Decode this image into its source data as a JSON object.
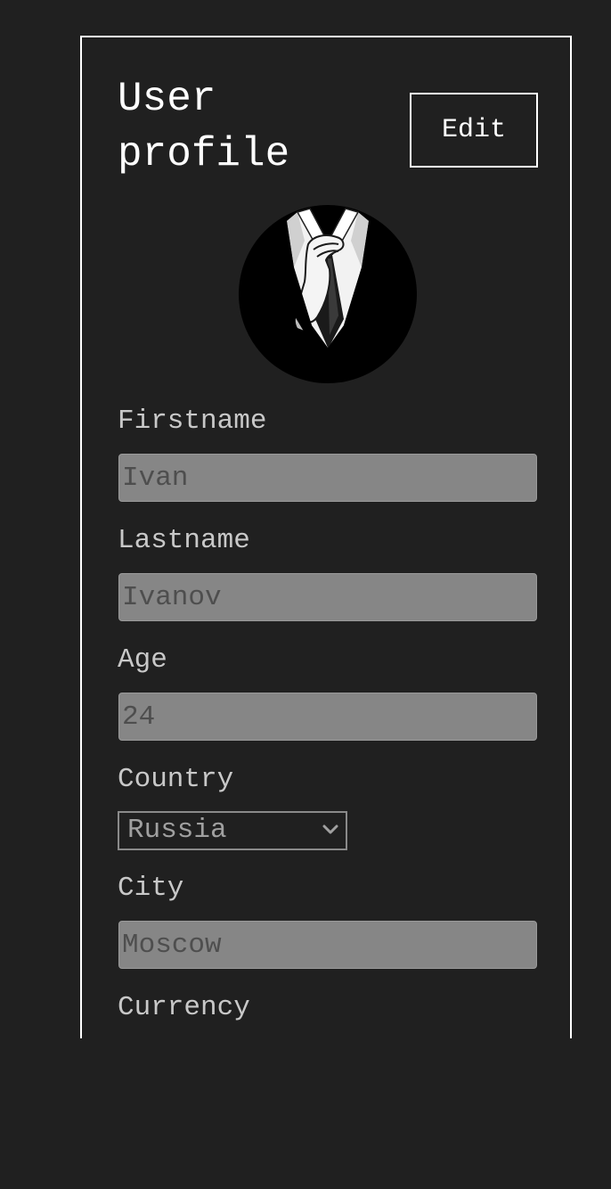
{
  "profile": {
    "title": "User profile",
    "edit_label": "Edit",
    "avatar_icon": "suit-tie-avatar-icon"
  },
  "form": {
    "firstname_label": "Firstname",
    "firstname_value": "Ivan",
    "lastname_label": "Lastname",
    "lastname_value": "Ivanov",
    "age_label": "Age",
    "age_value": "24",
    "country_label": "Country",
    "country_value": "Russia",
    "city_label": "City",
    "city_value": "Moscow",
    "currency_label": "Currency"
  },
  "colors": {
    "background": "#202020",
    "field_bg": "#868686",
    "field_text": "#4e4e4e",
    "label_text": "#c8c8c8",
    "accent": "#ffffff"
  }
}
